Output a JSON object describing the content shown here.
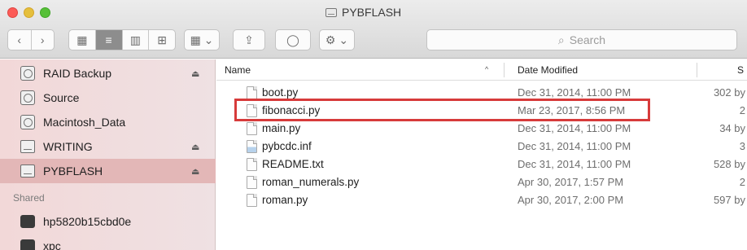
{
  "window": {
    "title": "PYBFLASH"
  },
  "toolbar": {
    "back_glyph": "‹",
    "forward_glyph": "›",
    "view_modes": [
      "▦",
      "≡",
      "▥",
      "⊞"
    ],
    "arrange_glyph": "▦ ⌄",
    "share_glyph": "⇪",
    "tag_glyph": "◯",
    "action_glyph": "⚙ ⌄",
    "search_icon": "⌕",
    "search_placeholder": "Search"
  },
  "sidebar": {
    "items": [
      {
        "label": "RAID Backup",
        "icon": "disk-icon",
        "eject": "⏏"
      },
      {
        "label": "Source",
        "icon": "disk-icon",
        "eject": ""
      },
      {
        "label": "Macintosh_Data",
        "icon": "disk-icon",
        "eject": ""
      },
      {
        "label": "WRITING",
        "icon": "external-drive-icon",
        "eject": "⏏"
      },
      {
        "label": "PYBFLASH",
        "icon": "external-drive-icon",
        "eject": "⏏",
        "selected": true
      }
    ],
    "shared_heading": "Shared",
    "shared_items": [
      {
        "label": "hp5820b15cbd0e",
        "icon": "computer-icon"
      },
      {
        "label": "xpc",
        "icon": "computer-icon"
      }
    ]
  },
  "columns": {
    "name": "Name",
    "sort_indicator": "^",
    "date": "Date Modified",
    "size": "S"
  },
  "files": [
    {
      "name": "boot.py",
      "date": "Dec 31, 2014, 11:00 PM",
      "size": "302 by",
      "icon": "document-icon"
    },
    {
      "name": "fibonacci.py",
      "date": "Mar 23, 2017, 8:56 PM",
      "size": "2",
      "icon": "document-icon",
      "highlighted": true
    },
    {
      "name": "main.py",
      "date": "Dec 31, 2014, 11:00 PM",
      "size": "34 by",
      "icon": "document-icon"
    },
    {
      "name": "pybcdc.inf",
      "date": "Dec 31, 2014, 11:00 PM",
      "size": "3",
      "icon": "setup-info-icon"
    },
    {
      "name": "README.txt",
      "date": "Dec 31, 2014, 11:00 PM",
      "size": "528 by",
      "icon": "document-icon"
    },
    {
      "name": "roman_numerals.py",
      "date": "Apr 30, 2017, 1:57 PM",
      "size": "2",
      "icon": "document-icon"
    },
    {
      "name": "roman.py",
      "date": "Apr 30, 2017, 2:00 PM",
      "size": "597 by",
      "icon": "document-icon"
    }
  ],
  "colors": {
    "highlight_border": "#d73b3b",
    "sidebar_selected": "#e3b7b7"
  }
}
